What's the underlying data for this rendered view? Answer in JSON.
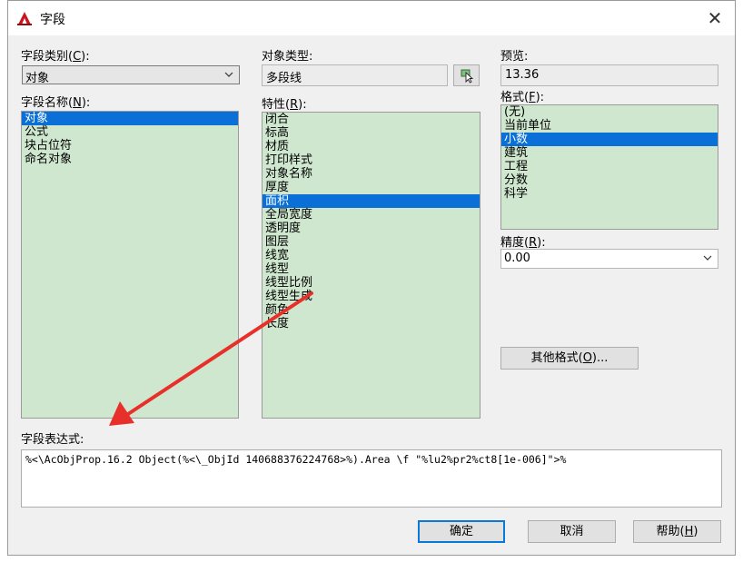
{
  "window": {
    "title": "字段",
    "close_glyph": "✕"
  },
  "field_category": {
    "label_prefix": "字段类别(",
    "label_key": "C",
    "label_suffix": "):",
    "value": "对象"
  },
  "field_names": {
    "label_prefix": "字段名称(",
    "label_key": "N",
    "label_suffix": "):",
    "items": [
      {
        "text": "对象",
        "selected": true
      },
      {
        "text": "公式",
        "selected": false
      },
      {
        "text": "块占位符",
        "selected": false
      },
      {
        "text": "命名对象",
        "selected": false
      }
    ]
  },
  "object_type": {
    "label": "对象类型:",
    "value": "多段线"
  },
  "properties": {
    "label_prefix": "特性(",
    "label_key": "R",
    "label_suffix": "):",
    "items": [
      {
        "text": "闭合",
        "selected": false
      },
      {
        "text": "标高",
        "selected": false
      },
      {
        "text": "材质",
        "selected": false
      },
      {
        "text": "打印样式",
        "selected": false
      },
      {
        "text": "对象名称",
        "selected": false
      },
      {
        "text": "厚度",
        "selected": false
      },
      {
        "text": "面积",
        "selected": true
      },
      {
        "text": "全局宽度",
        "selected": false
      },
      {
        "text": "透明度",
        "selected": false
      },
      {
        "text": "图层",
        "selected": false
      },
      {
        "text": "线宽",
        "selected": false
      },
      {
        "text": "线型",
        "selected": false
      },
      {
        "text": "线型比例",
        "selected": false
      },
      {
        "text": "线型生成",
        "selected": false
      },
      {
        "text": "颜色",
        "selected": false
      },
      {
        "text": "长度",
        "selected": false
      }
    ]
  },
  "preview": {
    "label": "预览:",
    "value": "13.36"
  },
  "format": {
    "label_prefix": "格式(",
    "label_key": "F",
    "label_suffix": "):",
    "items": [
      {
        "text": "(无)",
        "selected": false
      },
      {
        "text": "当前单位",
        "selected": false
      },
      {
        "text": "小数",
        "selected": true
      },
      {
        "text": "建筑",
        "selected": false
      },
      {
        "text": "工程",
        "selected": false
      },
      {
        "text": "分数",
        "selected": false
      },
      {
        "text": "科学",
        "selected": false
      }
    ]
  },
  "precision": {
    "label_prefix": "精度(",
    "label_key": "R",
    "label_suffix": "):",
    "value": "0.00"
  },
  "other_formats_button": {
    "prefix": "其他格式(",
    "key": "O",
    "suffix": ")..."
  },
  "expression": {
    "label": "字段表达式:",
    "value": "%<\\AcObjProp.16.2 Object(%<\\_ObjId 140688376224768>%).Area \\f \"%lu2%pr2%ct8[1e-006]\">%"
  },
  "buttons": {
    "ok": "确定",
    "cancel": "取消",
    "help_prefix": "帮助(",
    "help_key": "H",
    "help_suffix": ")"
  },
  "colors": {
    "list_bg": "#cfe7cf",
    "selection": "#0a6fd6",
    "annotation_arrow": "#e8302a",
    "default_button_border": "#0a78d7"
  }
}
